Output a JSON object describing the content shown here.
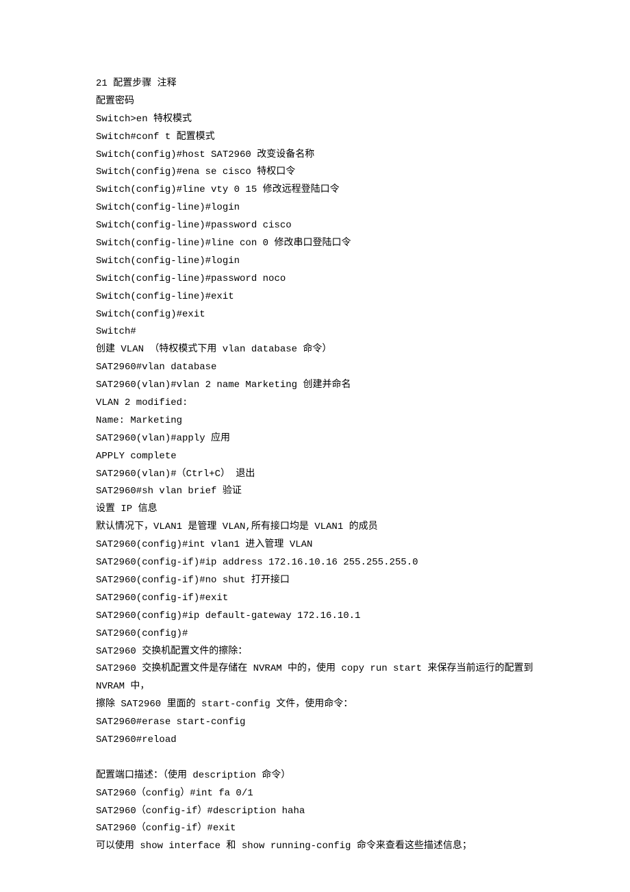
{
  "lines": [
    "21 配置步骤 注释",
    "配置密码",
    "Switch>en 特权模式",
    "Switch#conf t 配置模式",
    "Switch(config)#host SAT2960 改变设备名称",
    "Switch(config)#ena se cisco 特权口令",
    "Switch(config)#line vty 0 15 修改远程登陆口令",
    "Switch(config-line)#login",
    "Switch(config-line)#password cisco",
    "Switch(config-line)#line con 0 修改串口登陆口令",
    "Switch(config-line)#login",
    "Switch(config-line)#password noco",
    "Switch(config-line)#exit",
    "Switch(config)#exit",
    "Switch#",
    "创建 VLAN （特权模式下用 vlan database 命令）",
    "SAT2960#vlan database",
    "SAT2960(vlan)#vlan 2 name Marketing 创建并命名",
    "VLAN 2 modified:",
    "Name: Marketing",
    "SAT2960(vlan)#apply 应用",
    "APPLY complete",
    "SAT2960(vlan)#（Ctrl+C） 退出",
    "SAT2960#sh vlan brief 验证",
    "设置 IP 信息",
    "默认情况下，VLAN1 是管理 VLAN,所有接口均是 VLAN1 的成员",
    "SAT2960(config)#int vlan1 进入管理 VLAN",
    "SAT2960(config-if)#ip address 172.16.10.16 255.255.255.0",
    "SAT2960(config-if)#no shut 打开接口",
    "SAT2960(config-if)#exit",
    "SAT2960(config)#ip default-gateway 172.16.10.1",
    "SAT2960(config)#",
    "SAT2960 交换机配置文件的擦除：",
    "SAT2960 交换机配置文件是存储在 NVRAM 中的，使用 copy run start 来保存当前运行的配置到 NVRAM 中，",
    "擦除 SAT2960 里面的 start-config 文件，使用命令：",
    "SAT2960#erase start-config",
    "SAT2960#reload"
  ],
  "lines2": [
    "配置端口描述：（使用 description 命令）",
    "SAT2960（config）#int fa 0/1",
    "SAT2960（config-if）#description haha",
    "SAT2960（config-if）#exit",
    "可以使用 show interface 和 show running-config 命令来查看这些描述信息；"
  ]
}
